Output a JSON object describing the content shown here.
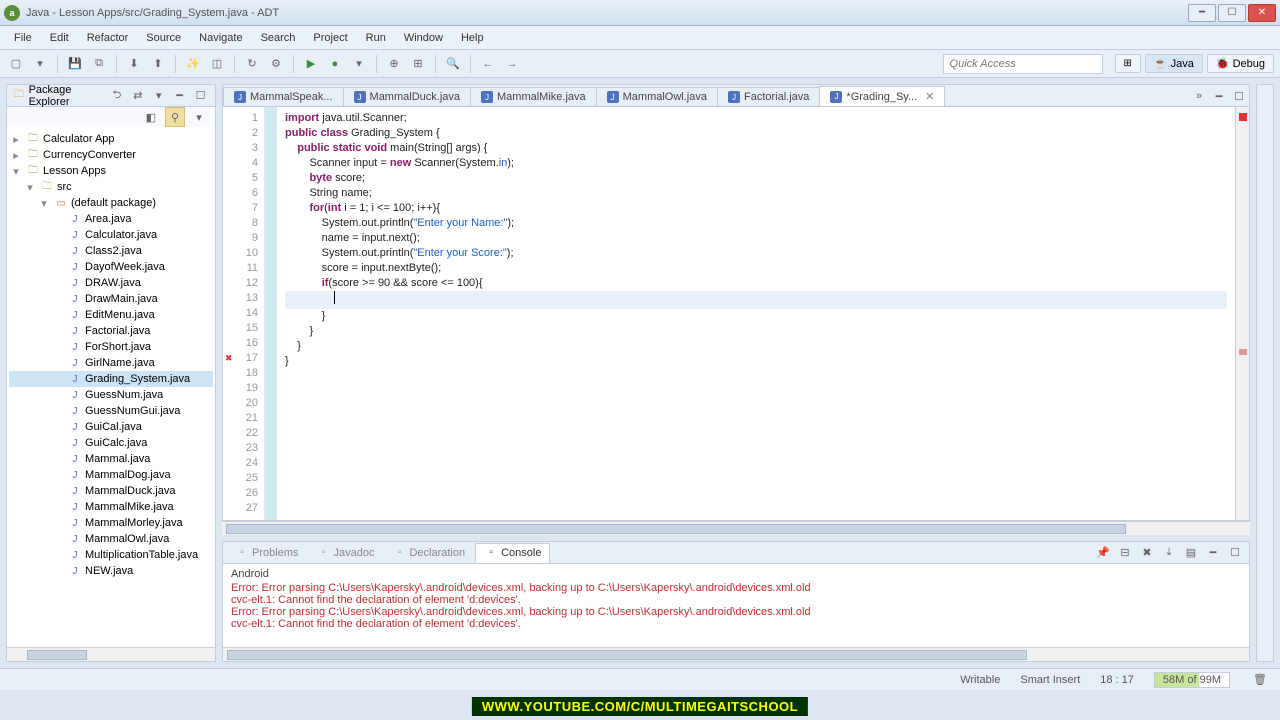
{
  "window": {
    "title": "Java - Lesson Apps/src/Grading_System.java - ADT",
    "app_icon_letter": "a"
  },
  "menu": [
    "File",
    "Edit",
    "Refactor",
    "Source",
    "Navigate",
    "Search",
    "Project",
    "Run",
    "Window",
    "Help"
  ],
  "quick_access_placeholder": "Quick Access",
  "perspectives": {
    "java": "Java",
    "debug": "Debug"
  },
  "package_explorer": {
    "title": "Package Explorer",
    "projects": [
      {
        "name": "Calculator App",
        "expanded": false
      },
      {
        "name": "CurrencyConverter",
        "expanded": false
      },
      {
        "name": "Lesson Apps",
        "expanded": true,
        "src": "src",
        "pkg": "(default package)",
        "files": [
          "Area.java",
          "Calculator.java",
          "Class2.java",
          "DayofWeek.java",
          "DRAW.java",
          "DrawMain.java",
          "EditMenu.java",
          "Factorial.java",
          "ForShort.java",
          "GirlName.java",
          "Grading_System.java",
          "GuessNum.java",
          "GuessNumGui.java",
          "GuiCal.java",
          "GuiCalc.java",
          "Mammal.java",
          "MammalDog.java",
          "MammalDuck.java",
          "MammalMike.java",
          "MammalMorley.java",
          "MammalOwl.java",
          "MultiplicationTable.java",
          "NEW.java"
        ]
      }
    ]
  },
  "editor_tabs": [
    {
      "label": "MammalSpeak...",
      "active": false
    },
    {
      "label": "MammalDuck.java",
      "active": false
    },
    {
      "label": "MammalMike.java",
      "active": false
    },
    {
      "label": "MammalOwl.java",
      "active": false
    },
    {
      "label": "Factorial.java",
      "active": false
    },
    {
      "label": "*Grading_Sy...",
      "active": true
    }
  ],
  "code": {
    "lines": [
      {
        "n": 1,
        "html": "<span class='kw'>import</span> java.util.Scanner;"
      },
      {
        "n": 2,
        "html": "<span class='kw'>public class</span> Grading_System {"
      },
      {
        "n": 3,
        "html": ""
      },
      {
        "n": 4,
        "html": "    <span class='kw'>public static void</span> main(String[] args) {"
      },
      {
        "n": 5,
        "html": "        Scanner input = <span class='kw'>new</span> Scanner(System.<span style='color:#2060c0'>in</span>);"
      },
      {
        "n": 6,
        "html": "        <span class='kw'>byte</span> score;"
      },
      {
        "n": 7,
        "html": "        String name;"
      },
      {
        "n": 8,
        "html": ""
      },
      {
        "n": 9,
        "html": "        <span class='kw'>for</span>(<span class='kw'>int</span> i = 1; i &lt;= 100; i++){"
      },
      {
        "n": 10,
        "html": ""
      },
      {
        "n": 11,
        "html": "            System.out.println(<span class='str'>\"Enter your Name:\"</span>);"
      },
      {
        "n": 12,
        "html": "            name = input.next();"
      },
      {
        "n": 13,
        "html": ""
      },
      {
        "n": 14,
        "html": "            System.out.println(<span class='str'>\"Enter your Score:\"</span>);"
      },
      {
        "n": 15,
        "html": "            score = input.nextByte();"
      },
      {
        "n": 16,
        "html": ""
      },
      {
        "n": 17,
        "html": "            <span class='kw'>if</span>(score &gt;= 90 &amp;&amp; score &lt;= 100){",
        "err": true
      },
      {
        "n": 18,
        "html": "                ",
        "cursor": true
      },
      {
        "n": 19,
        "html": "            }"
      },
      {
        "n": 20,
        "html": ""
      },
      {
        "n": 21,
        "html": ""
      },
      {
        "n": 22,
        "html": "        }"
      },
      {
        "n": 23,
        "html": ""
      },
      {
        "n": 24,
        "html": ""
      },
      {
        "n": 25,
        "html": "    }"
      },
      {
        "n": 26,
        "html": ""
      },
      {
        "n": 27,
        "html": "}"
      }
    ]
  },
  "bottom_tabs": [
    "Problems",
    "Javadoc",
    "Declaration",
    "Console"
  ],
  "console": {
    "header": "Android",
    "lines": [
      "Error: Error parsing C:\\Users\\Kapersky\\.android\\devices.xml, backing up to C:\\Users\\Kapersky\\.android\\devices.xml.old",
      "cvc-elt.1: Cannot find the declaration of element 'd:devices'.",
      "Error: Error parsing C:\\Users\\Kapersky\\.android\\devices.xml, backing up to C:\\Users\\Kapersky\\.android\\devices.xml.old",
      "cvc-elt.1: Cannot find the declaration of element 'd:devices'."
    ]
  },
  "status": {
    "writable": "Writable",
    "insert": "Smart Insert",
    "pos": "18 : 17",
    "mem": "58M of 99M"
  },
  "youtube_bar": "WWW.YOUTUBE.COM/C/MULTIMEGAITSCHOOL"
}
